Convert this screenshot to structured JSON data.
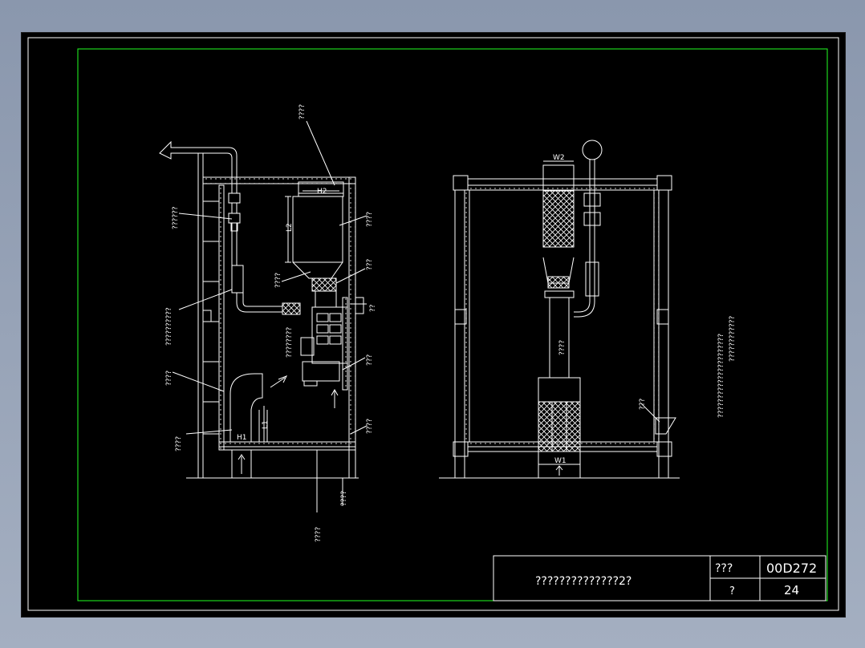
{
  "title_block": {
    "drawing_title": "??????????????2?",
    "label_a": "???",
    "value_a": "00D272",
    "label_b": "?",
    "value_b": "24"
  },
  "left_view": {
    "dim_h2": "H2",
    "dim_l2": "L2",
    "dim_h1": "H1",
    "dim_l1": "L1",
    "callout_top": "????",
    "callout_duct": "??????",
    "callout_pipe": "??????????",
    "callout_wall": "????",
    "callout_floor": "????",
    "callout_unit": "????",
    "callout_fan": "???",
    "callout_fan_left": "????",
    "callout_valve": "??",
    "callout_motor": "????????",
    "callout_base": "???",
    "callout_right_bottom": "????",
    "callout_ground": "????",
    "callout_bottom_axis": "????"
  },
  "right_view": {
    "dim_w2": "W2",
    "dim_w1": "W1",
    "callout_body": "????",
    "callout_hopper": "???"
  },
  "notes": {
    "line1": "??????????????????????",
    "line2": "????????????"
  },
  "colors": {
    "line": "#ffffff",
    "border": "#22ff22",
    "background": "#000000"
  }
}
